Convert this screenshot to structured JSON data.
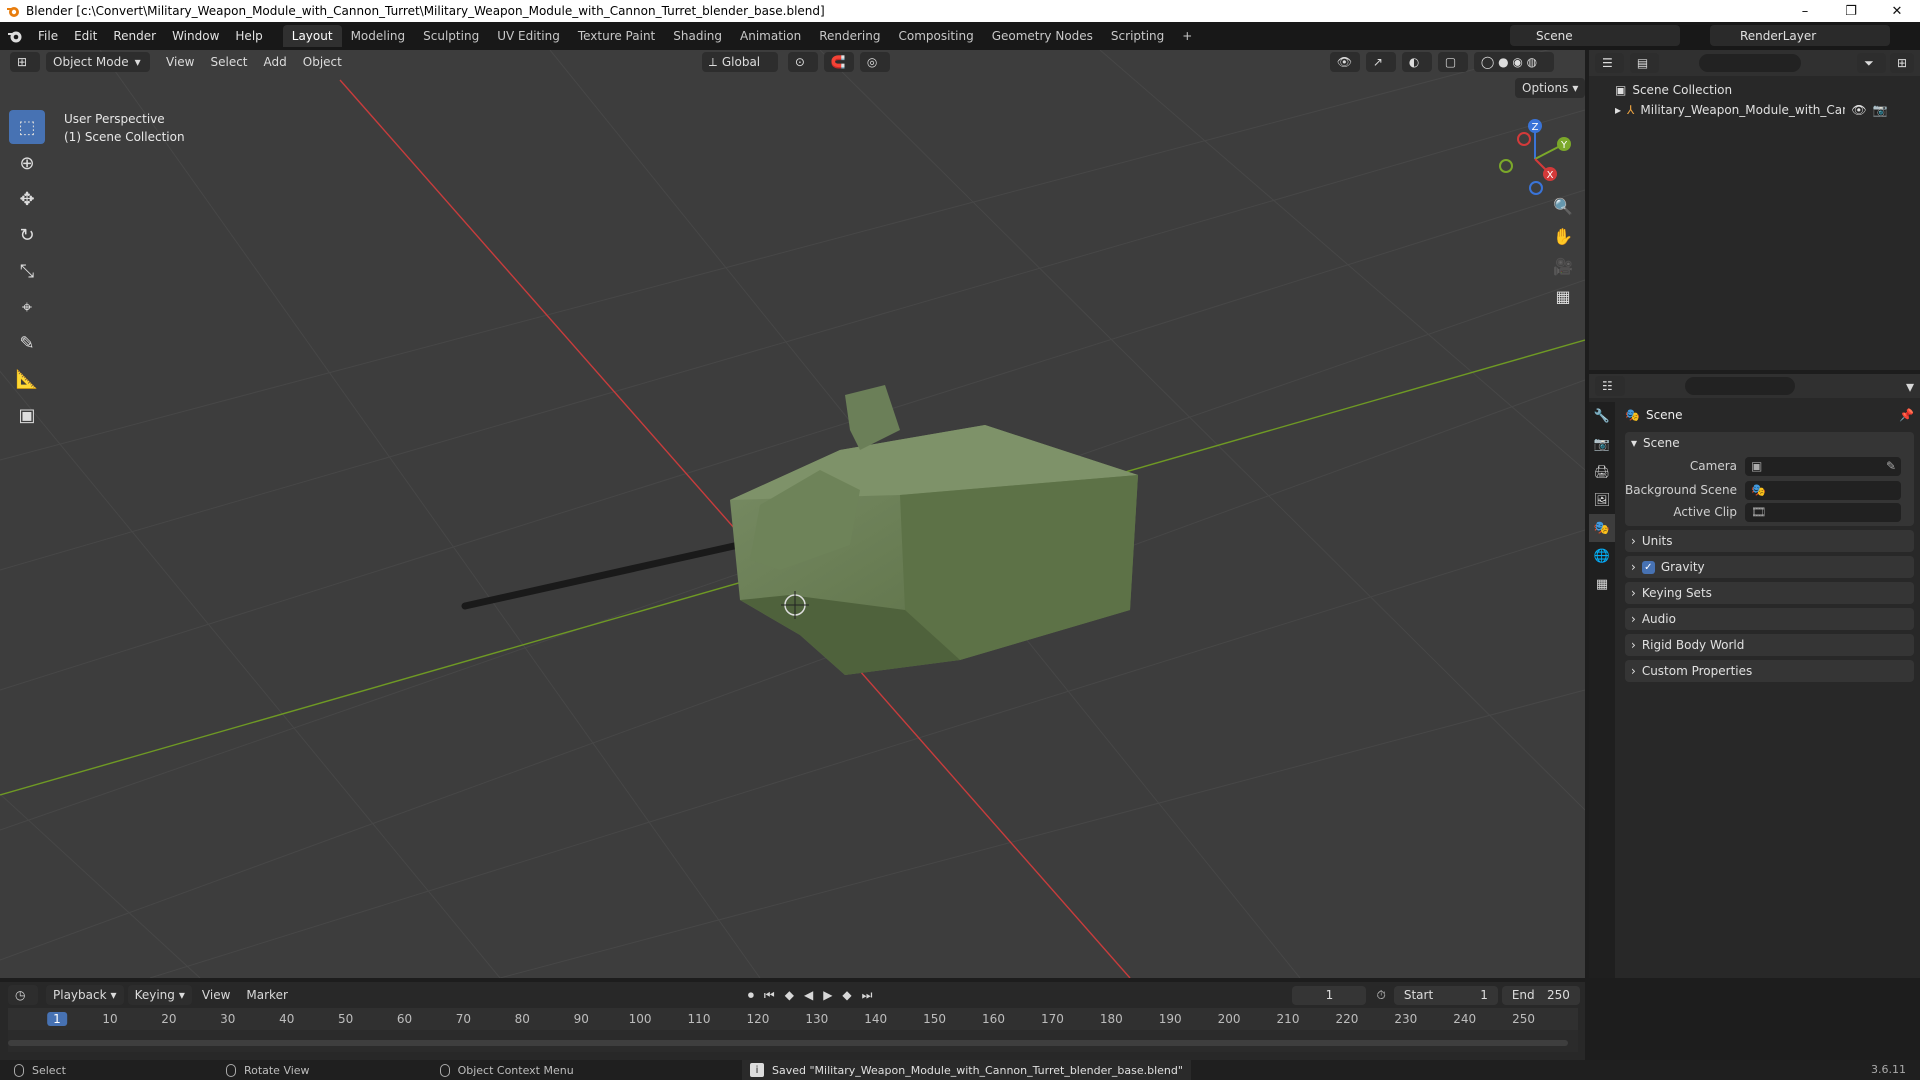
{
  "window": {
    "title": "Blender [c:\\Convert\\Military_Weapon_Module_with_Cannon_Turret\\Military_Weapon_Module_with_Cannon_Turret_blender_base.blend]",
    "controls": [
      "–",
      "❐",
      "✕"
    ]
  },
  "menu": {
    "items": [
      "File",
      "Edit",
      "Render",
      "Window",
      "Help"
    ],
    "workspaces": [
      "Layout",
      "Modeling",
      "Sculpting",
      "UV Editing",
      "Texture Paint",
      "Shading",
      "Animation",
      "Rendering",
      "Compositing",
      "Geometry Nodes",
      "Scripting",
      "+"
    ],
    "active_workspace": "Layout",
    "scene": "Scene",
    "view_layer": "RenderLayer"
  },
  "viewport": {
    "mode": "Object Mode",
    "menus": [
      "View",
      "Select",
      "Add",
      "Object"
    ],
    "orientation": "Global",
    "options_label": "Options",
    "info_line1": "User Perspective",
    "info_line2": "(1) Scene Collection",
    "gizmo_axes": [
      "Z",
      "Y",
      "X"
    ]
  },
  "outliner": {
    "root": "Scene Collection",
    "object": "Military_Weapon_Module_with_Cannon_"
  },
  "properties": {
    "title": "Scene",
    "panel_scene": "Scene",
    "rows": [
      {
        "label": "Camera",
        "value": ""
      },
      {
        "label": "Background Scene",
        "value": ""
      },
      {
        "label": "Active Clip",
        "value": ""
      }
    ],
    "panels": [
      "Units",
      "Gravity",
      "Keying Sets",
      "Audio",
      "Rigid Body World",
      "Custom Properties"
    ],
    "gravity_checked": true
  },
  "timeline": {
    "menus": [
      "Playback",
      "Keying",
      "View",
      "Marker"
    ],
    "current_frame": "1",
    "start_label": "Start",
    "start": "1",
    "end_label": "End",
    "end": "250",
    "ticks": [
      "1",
      "10",
      "20",
      "30",
      "40",
      "50",
      "60",
      "70",
      "80",
      "90",
      "100",
      "110",
      "120",
      "130",
      "140",
      "150",
      "160",
      "170",
      "180",
      "190",
      "200",
      "210",
      "220",
      "230",
      "240",
      "250"
    ]
  },
  "status": {
    "select": "Select",
    "rotate": "Rotate View",
    "context": "Object Context Menu",
    "saved": "Saved \"Military_Weapon_Module_with_Cannon_Turret_blender_base.blend\"",
    "version": "3.6.11"
  },
  "colors": {
    "accent": "#4772b3",
    "axis_x": "#d33a3a",
    "axis_y": "#7ba82a",
    "axis_z": "#3a74d8",
    "turret": "#62774f"
  }
}
